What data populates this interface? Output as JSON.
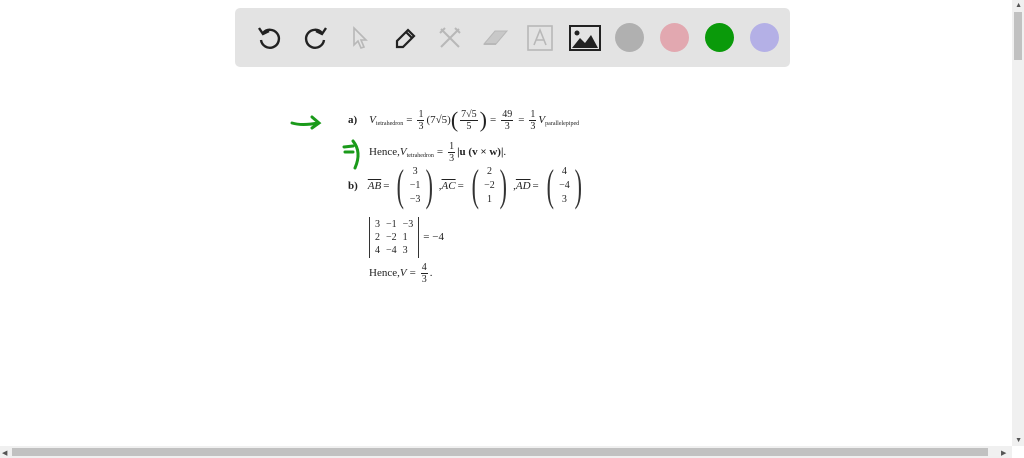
{
  "toolbar": {
    "tools": [
      "undo-icon",
      "redo-icon",
      "select-icon",
      "pen-icon",
      "tools-icon",
      "eraser-icon",
      "text-icon",
      "image-icon"
    ],
    "colors": [
      "#b0b0b0",
      "#e2a8b0",
      "#0a9a0a",
      "#b4b0e6"
    ]
  },
  "annotation_color": "#1a9a1a",
  "math": {
    "a": {
      "label": "a)",
      "V": "V",
      "sub_tet": "tetrahedron",
      "eq": "=",
      "one": "1",
      "three": "3",
      "p1": "(7√5)",
      "n7": "7√5",
      "d5": "5",
      "n49": "49",
      "sub_par": "parallelepiped"
    },
    "hence1": {
      "text": "Hence, ",
      "V": "V",
      "sub": "tetrahedron",
      "eq": "=",
      "one": "1",
      "three": "3",
      "expr": "|u (v × w)|",
      "end": "."
    },
    "b": {
      "label": "b)",
      "AB": "AB",
      "AC": "AC",
      "AD": "AD",
      "eq": "=",
      "comma": ",",
      "ab": [
        "3",
        "−1",
        "−3"
      ],
      "ac": [
        "2",
        "−2",
        "1"
      ],
      "ad": [
        "4",
        "−4",
        "3"
      ]
    },
    "det": {
      "cells": [
        "3",
        "−1",
        "−3",
        "2",
        "−2",
        "1",
        "4",
        "−4",
        "3"
      ],
      "result": "= −4"
    },
    "hence2": {
      "text": "Hence, ",
      "V": "V",
      "eq": "=",
      "num": "4",
      "den": "3",
      "end": "."
    }
  }
}
